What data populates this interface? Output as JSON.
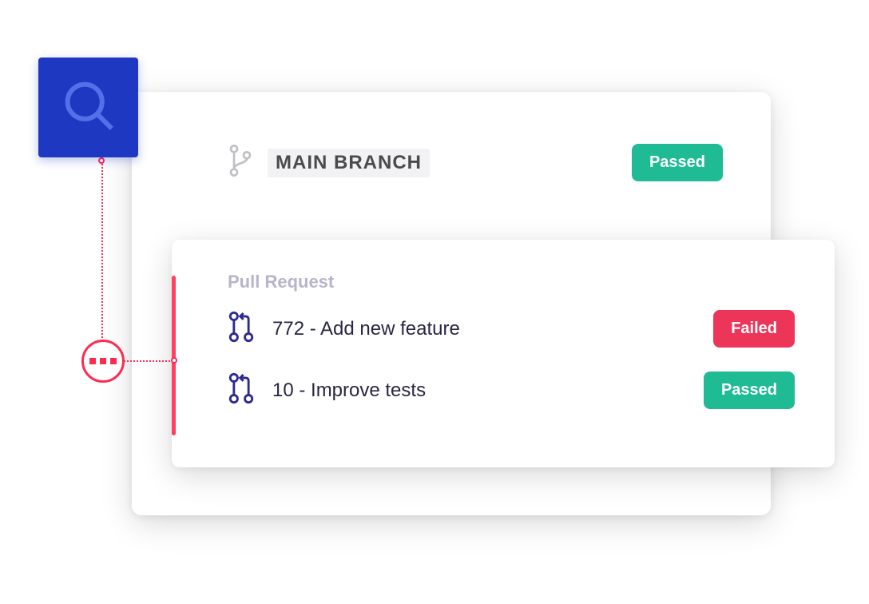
{
  "main": {
    "branch_label": "MAIN BRANCH",
    "status": "Passed"
  },
  "pr_card": {
    "header": "Pull Request",
    "items": [
      {
        "title": "772 - Add new feature",
        "status": "Failed"
      },
      {
        "title": "10 - Improve tests",
        "status": "Passed"
      }
    ]
  },
  "icons": {
    "search": "search-icon",
    "branch": "git-branch-icon",
    "pr": "pull-request-icon",
    "dots": "more-icon"
  }
}
